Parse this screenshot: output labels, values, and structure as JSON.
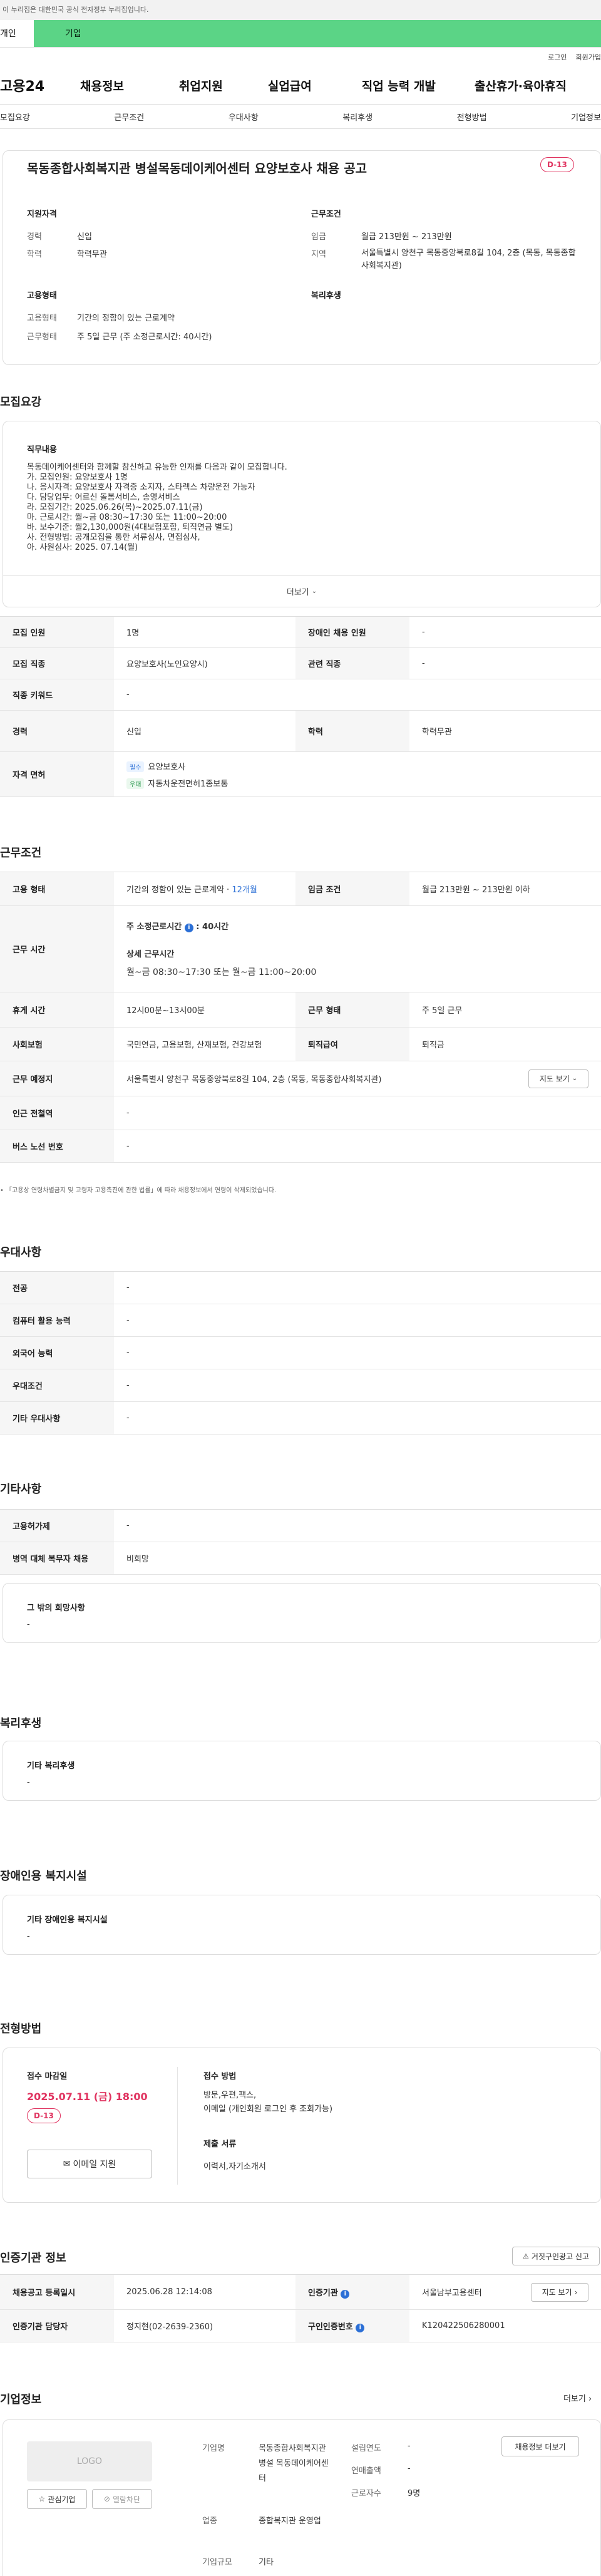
{
  "gov_banner": "이 누리집은 대한민국 공식 전자정부 누리집입니다.",
  "tabs": {
    "personal": "개인",
    "corp": "기업"
  },
  "util": {
    "login": "로그인",
    "join": "회원가입"
  },
  "gnb": {
    "logo": "고용24",
    "items": [
      "채용정보",
      "취업지원",
      "실업급여",
      "직업 능력 개발",
      "출산휴가·육아휴직"
    ]
  },
  "anchor_nav": [
    "모집요강",
    "근무조건",
    "우대사항",
    "복리후생",
    "전형방법",
    "기업정보"
  ],
  "job": {
    "title": "목동종합사회복지관 병설목동데이케어센터 요양보호사 채용 공고",
    "dday": "D-13",
    "qual_h": "지원자격",
    "cond_h": "근무조건",
    "emp_h": "고용형태",
    "welfare_h": "복리후생",
    "career_k": "경력",
    "career_v": "신입",
    "edu_k": "학력",
    "edu_v": "학력무관",
    "pay_k": "임금",
    "pay_v": "월급 213만원 ~ 213만원",
    "region_k": "지역",
    "region_v": "서울특별시 양천구 목동중앙북로8길 104, 2층 (목동, 목동종합사회복지관)",
    "etype_k": "고용형태",
    "etype_v": "기간의 정함이 있는 근로계약",
    "wform_k": "근무형태",
    "wform_v": "주 5일 근무 (주 소정근로시간: 40시간)"
  },
  "recruit": {
    "heading": "모집요강",
    "duty_h": "직무내용",
    "duty_lines": [
      "목동데이케어센터와 함께할 참신하고 유능한 인재를 다음과 같이 모집합니다.",
      "가. 모집인원: 요양보호사 1명",
      "나. 응시자격: 요양보호사 자격증 소지자, 스타렉스 차량운전 가능자",
      "다. 담당업무: 어르신 돌봄서비스, 송영서비스",
      "라. 모집기간: 2025.06.26(목)~2025.07.11(금)",
      "마. 근로시간: 월~금 08:30~17:30 또는 11:00~20:00",
      "바. 보수기준: 월2,130,000원(4대보험포함, 퇴직연금 별도)",
      "사. 전형방법: 공개모집을 통한 서류심사, 면접심사,",
      "아. 사원심사: 2025. 07.14(월)"
    ],
    "more": "더보기",
    "rows": {
      "count_k": "모집 인원",
      "count_v": "1명",
      "dis_k": "장애인 채용 인원",
      "dis_v": "-",
      "job_k": "모집 직종",
      "job_v": "요양보호사(노인요양시)",
      "rel_k": "관련 직종",
      "rel_v": "-",
      "kw_k": "직종 키워드",
      "kw_v": "-",
      "career_k": "경력",
      "career_v": "신입",
      "edu_k": "학력",
      "edu_v": "학력무관",
      "lic_k": "자격 면허",
      "lic": [
        {
          "badge": "필수",
          "name": "요양보호사"
        },
        {
          "badge": "우대",
          "name": "자동차운전면허1종보통"
        }
      ]
    }
  },
  "condition": {
    "heading": "근무조건",
    "etype_k": "고용 형태",
    "etype_v": "기간의 정함이 있는 근로계약 · ",
    "etype_months": "12개월",
    "pay_k": "임금 조건",
    "pay_v": "월급 213만원 ~ 213만원 이하",
    "hours_k": "근무 시간",
    "hours_main": "주 소정근로시간",
    "hours_val": "40시간",
    "hours_detail_h": "상세 근무시간",
    "hours_detail": "월~금 08:30~17:30 또는 월~금 11:00~20:00",
    "break_k": "휴게 시간",
    "break_v": "12시00분~13시00분",
    "wform_k": "근무 형태",
    "wform_v": "주 5일 근무",
    "ins_k": "사회보험",
    "ins_v": "국민연금, 고용보험, 산재보험, 건강보험",
    "ret_k": "퇴직급여",
    "ret_v": "퇴직금",
    "place_k": "근무 예정지",
    "place_v": "서울특별시 양천구 목동중앙북로8길 104, 2층 (목동, 목동종합사회복지관)",
    "map_btn": "지도 보기",
    "subway_k": "인근 전철역",
    "subway_v": "-",
    "bus_k": "버스 노선 번호",
    "bus_v": "-",
    "note": "「고용상 연령차별금지 및 고령자 고용촉진에 관한 법률」에 따라 채용정보에서 연령이 삭제되었습니다."
  },
  "pref": {
    "heading": "우대사항",
    "rows": [
      {
        "k": "전공",
        "v": "-"
      },
      {
        "k": "컴퓨터 활용 능력",
        "v": "-"
      },
      {
        "k": "외국어 능력",
        "v": "-"
      },
      {
        "k": "우대조건",
        "v": "-"
      },
      {
        "k": "기타 우대사항",
        "v": "-"
      }
    ]
  },
  "etc": {
    "heading": "기타사항",
    "rows": [
      {
        "k": "고용허가제",
        "v": "-"
      },
      {
        "k": "병역 대체 복무자 채용",
        "v": "비희망"
      }
    ],
    "other_h": "그 밖의 희망사항",
    "other_v": "-"
  },
  "welfare": {
    "heading": "복리후생",
    "box_h": "기타 복리후생",
    "box_v": "-"
  },
  "disab": {
    "heading": "장애인용 복지시설",
    "box_h": "기타 장애인용 복지시설",
    "box_v": "-"
  },
  "selection": {
    "heading": "전형방법",
    "deadline_h": "접수 마감일",
    "deadline": "2025.07.11 (금) 18:00",
    "dday": "D-13",
    "email_btn": "이메일 지원",
    "method_h": "접수 방법",
    "method_v1": "방문,우편,팩스,",
    "method_v2": "이메일 (개인회원 로그인 후 조회가능)",
    "docs_h": "제출 서류",
    "docs_v": "이력서,자기소개서"
  },
  "cert": {
    "heading": "인증기관 정보",
    "report_btn": "거짓구인광고 신고",
    "reg_k": "채용공고 등록일시",
    "reg_v": "2025.06.28 12:14:08",
    "org_k": "인증기관",
    "org_v": "서울남부고용센터",
    "map_btn": "지도 보기",
    "mgr_k": "인증기관 담당자",
    "mgr_v": "정지현(02-2639-2360)",
    "no_k": "구인인증번호",
    "no_v": "K120422506280001"
  },
  "company": {
    "heading": "기업정보",
    "more": "더보기",
    "logo": "LOGO",
    "fav_btn": "관심기업",
    "block_btn": "열람차단",
    "jobs_btn": "채용정보 더보기",
    "name_k": "기업명",
    "name_v": "목동종합사회복지관 병설 목동데이케어센터",
    "biz_k": "업종",
    "biz_v": "종합복지관 운영업",
    "size_k": "기업규모",
    "size_v": "기타",
    "year_k": "설립연도",
    "year_v": "-",
    "sales_k": "연매출액",
    "sales_v": "-",
    "emp_k": "근로자수",
    "emp_v": "9명"
  }
}
